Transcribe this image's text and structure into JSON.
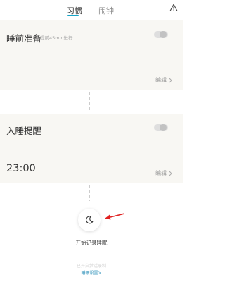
{
  "tabs": {
    "habit_label": "习惯",
    "alarm_label": "闹钟",
    "active": "habit",
    "accent_color": "#16a4c7"
  },
  "header": {
    "warning_icon": "warning-triangle-icon"
  },
  "sleep_prep_card": {
    "title": "睡前准备",
    "hint": "提前45min进行",
    "toggle_on": false,
    "edit_label": "编辑"
  },
  "sleep_reminder_card": {
    "title": "入睡提醒",
    "time": "23:00",
    "toggle_on": false,
    "edit_label": "编辑"
  },
  "record": {
    "button_icon": "moon-icon",
    "start_label": "开始记录睡眠",
    "faint_text": "已开启梦话录制",
    "settings_link": "睡眠设置>"
  },
  "annotation_color": "#e02020"
}
